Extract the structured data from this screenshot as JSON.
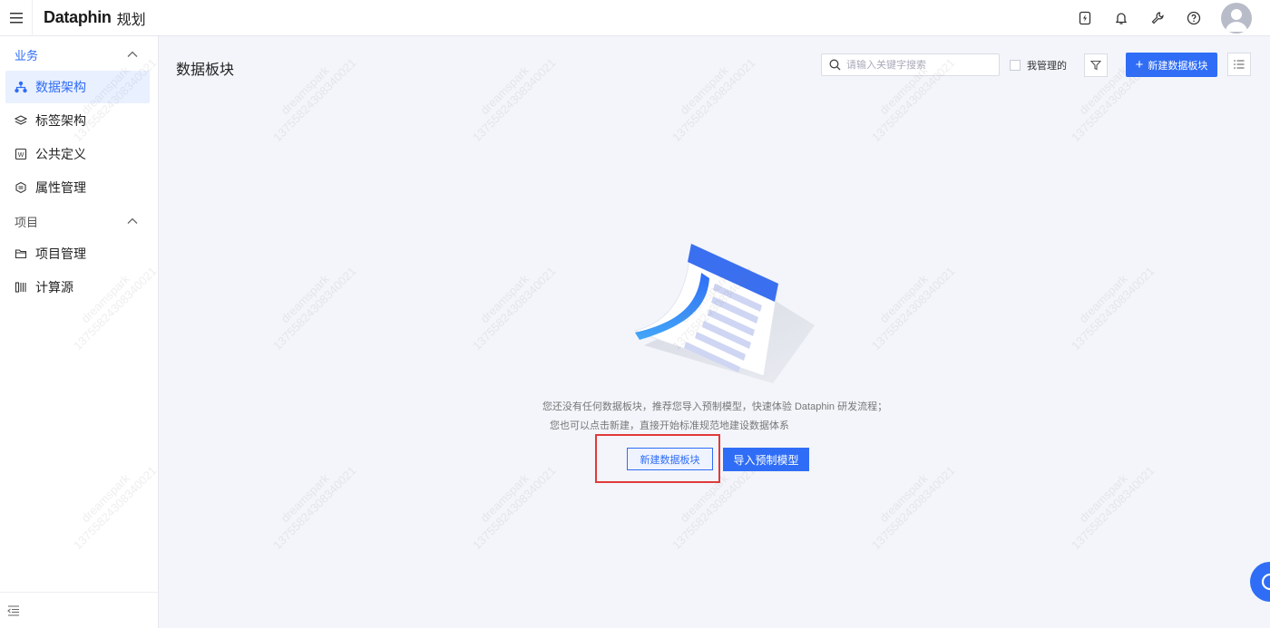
{
  "brand": {
    "logo": "Dataphin",
    "module": "规划"
  },
  "topbar": {
    "icons": [
      "upgrade-icon",
      "bell-icon",
      "wrench-icon",
      "help-icon"
    ]
  },
  "sidebar": {
    "groups": [
      {
        "title": "业务",
        "items": [
          {
            "label": "数据架构",
            "icon": "sitemap-icon",
            "active": true
          },
          {
            "label": "标签架构",
            "icon": "layers-icon"
          },
          {
            "label": "公共定义",
            "icon": "doc-icon"
          },
          {
            "label": "属性管理",
            "icon": "attr-icon"
          }
        ]
      },
      {
        "title": "项目",
        "items": [
          {
            "label": "项目管理",
            "icon": "folder-icon"
          },
          {
            "label": "计算源",
            "icon": "compute-icon"
          }
        ]
      }
    ]
  },
  "main": {
    "title": "数据板块",
    "search_placeholder": "请输入关键字搜索",
    "mine_label": "我管理的",
    "new_button": "新建数据板块",
    "empty": {
      "line1": "您还没有任何数据板块，推荐您导入预制模型，快速体验 Dataphin 研发流程；",
      "line2": "您也可以点击新建，直接开始标准规范地建设数据体系",
      "new_button": "新建数据板块",
      "import_button": "导入预制模型"
    }
  },
  "watermark": {
    "line1": "dreamspark",
    "line2": "13755824308340021"
  },
  "colors": {
    "accent": "#2f6df6",
    "highlight": "#e03a3a"
  }
}
